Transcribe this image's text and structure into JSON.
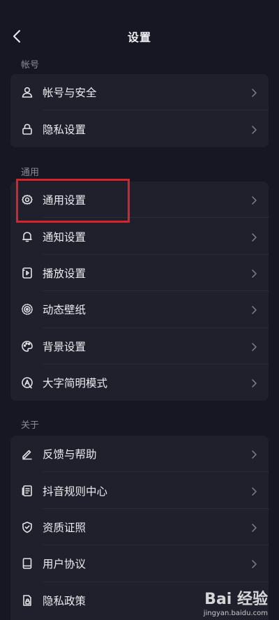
{
  "header": {
    "title": "设置",
    "back_icon": "back-arrow-icon"
  },
  "sections": [
    {
      "label": "帐号",
      "items": [
        {
          "label": "帐号与安全",
          "icon": "user-icon"
        },
        {
          "label": "隐私设置",
          "icon": "lock-icon"
        }
      ]
    },
    {
      "label": "通用",
      "items": [
        {
          "label": "通用设置",
          "icon": "gear-icon"
        },
        {
          "label": "通知设置",
          "icon": "bell-icon"
        },
        {
          "label": "播放设置",
          "icon": "play-settings-icon"
        },
        {
          "label": "动态壁纸",
          "icon": "live-wallpaper-icon"
        },
        {
          "label": "背景设置",
          "icon": "palette-icon"
        },
        {
          "label": "大字简明模式",
          "icon": "large-text-icon"
        }
      ]
    },
    {
      "label": "关于",
      "items": [
        {
          "label": "反馈与帮助",
          "icon": "edit-pen-icon"
        },
        {
          "label": "抖音规则中心",
          "icon": "rules-doc-icon"
        },
        {
          "label": "资质证照",
          "icon": "shield-check-icon"
        },
        {
          "label": "用户协议",
          "icon": "book-icon"
        },
        {
          "label": "隐私政策",
          "icon": "privacy-doc-icon"
        }
      ]
    }
  ],
  "colors": {
    "background": "#161722",
    "card": "#1f202c",
    "highlight": "#d9232b"
  },
  "watermark": {
    "main": "Bai 经验",
    "sub": "jingyan.baidu.com"
  }
}
